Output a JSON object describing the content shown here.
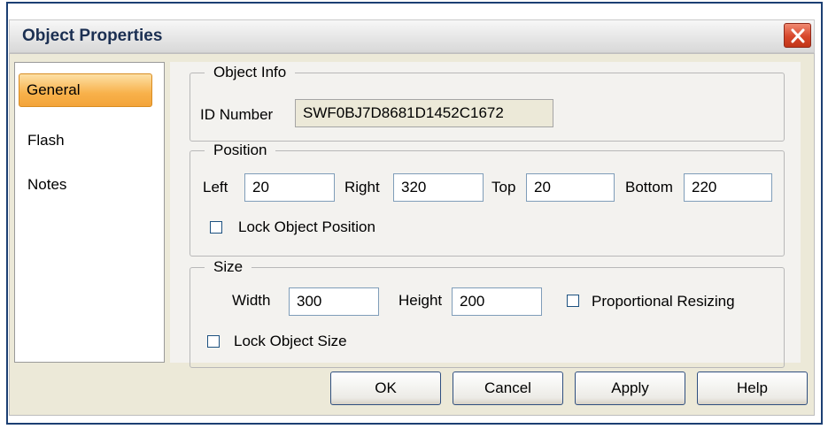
{
  "window": {
    "title": "Object Properties"
  },
  "sidebar": {
    "items": [
      {
        "label": "General",
        "active": true
      },
      {
        "label": "Flash",
        "active": false
      },
      {
        "label": "Notes",
        "active": false
      }
    ]
  },
  "object_info": {
    "legend": "Object Info",
    "id_label": "ID Number",
    "id_value": "SWF0BJ7D8681D1452C1672"
  },
  "position": {
    "legend": "Position",
    "left_label": "Left",
    "left_value": "20",
    "right_label": "Right",
    "right_value": "320",
    "top_label": "Top",
    "top_value": "20",
    "bottom_label": "Bottom",
    "bottom_value": "220",
    "lock_label": "Lock Object Position",
    "lock_checked": false
  },
  "size": {
    "legend": "Size",
    "width_label": "Width",
    "width_value": "300",
    "height_label": "Height",
    "height_value": "200",
    "proportional_label": "Proportional Resizing",
    "proportional_checked": false,
    "lock_label": "Lock Object Size",
    "lock_checked": false
  },
  "buttons": {
    "ok": "OK",
    "cancel": "Cancel",
    "apply": "Apply",
    "help": "Help"
  }
}
